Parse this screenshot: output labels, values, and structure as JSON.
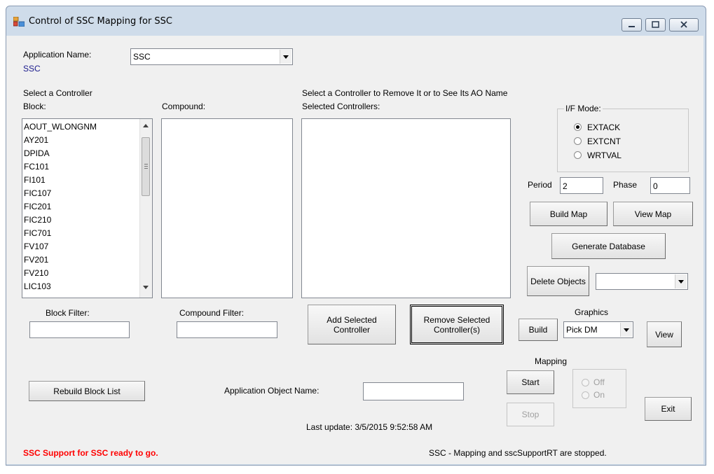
{
  "window": {
    "title": "Control of SSC Mapping for SSC"
  },
  "app": {
    "name_label": "Application Name:",
    "name_value": "SSC",
    "combo_value": "SSC"
  },
  "selector": {
    "heading": "Select a Controller",
    "block_label": "Block:",
    "compound_label": "Compound:",
    "selected_heading": "Select a Controller to Remove It or to See Its AO Name",
    "selected_label": "Selected Controllers:",
    "blocks": [
      "AOUT_WLONGNM",
      "AY201",
      "DPIDA",
      "FC101",
      "FI101",
      "FIC107",
      "FIC201",
      "FIC210",
      "FIC701",
      "FV107",
      "FV201",
      "FV210",
      "LIC103"
    ]
  },
  "ifmode": {
    "legend": "I/F Mode:",
    "options": [
      "EXTACK",
      "EXTCNT",
      "WRTVAL"
    ],
    "selected": "EXTACK"
  },
  "timing": {
    "period_label": "Period",
    "period_value": "2",
    "phase_label": "Phase",
    "phase_value": "0"
  },
  "buttons": {
    "build_map": "Build Map",
    "view_map": "View Map",
    "generate_db": "Generate Database",
    "delete_objects": "Delete Objects",
    "add_selected": "Add Selected Controller",
    "remove_selected": "Remove Selected Controller(s)",
    "rebuild_block_list": "Rebuild Block List",
    "graphics_build": "Build",
    "graphics_view": "View",
    "start": "Start",
    "stop": "Stop",
    "exit": "Exit"
  },
  "filters": {
    "block_filter_label": "Block Filter:",
    "compound_filter_label": "Compound Filter:"
  },
  "graphics": {
    "label": "Graphics",
    "combo_value": "Pick DM"
  },
  "mapping": {
    "label": "Mapping",
    "off": "Off",
    "on": "On"
  },
  "ao": {
    "label": "Application Object Name:"
  },
  "status": {
    "last_update": "Last update: 3/5/2015 9:52:58 AM",
    "left_message": "SSC Support for SSC ready to go.",
    "right_message": "SSC - Mapping and sscSupportRT are stopped."
  },
  "colors": {
    "app_name_value": "#1a1a8c",
    "left_message": "#ff0000"
  },
  "icons": {
    "app_icon": "app-window-icon",
    "minimize": "minimize-icon",
    "maximize": "maximize-icon",
    "close": "close-icon"
  }
}
